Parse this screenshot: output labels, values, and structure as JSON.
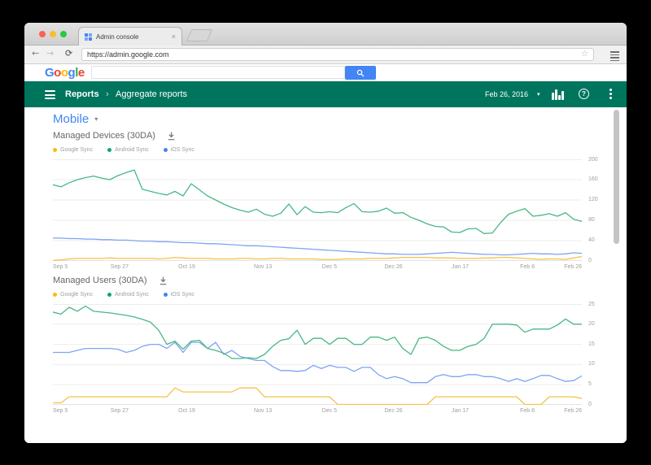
{
  "browser": {
    "tab_title": "Admin console",
    "tab_close": "×",
    "url": "https://admin.google.com",
    "back_icon": "←",
    "forward_icon": "→",
    "reload_icon": "⟳",
    "bookmark_star": "☆"
  },
  "google_bar": {
    "logo_letters": [
      {
        "ch": "G",
        "color": "#4285F4"
      },
      {
        "ch": "o",
        "color": "#EA4335"
      },
      {
        "ch": "o",
        "color": "#FBBC05"
      },
      {
        "ch": "g",
        "color": "#4285F4"
      },
      {
        "ch": "l",
        "color": "#34A853"
      },
      {
        "ch": "e",
        "color": "#EA4335"
      }
    ],
    "search_value": "",
    "search_button_icon": "magnifier"
  },
  "header": {
    "menu_icon": "hamburger",
    "breadcrumb_root": "Reports",
    "breadcrumb_separator": "›",
    "breadcrumb_current": "Aggregate reports",
    "date_label": "Feb 26, 2016",
    "date_caret": "▾",
    "right_icons": [
      "reports-bars",
      "help",
      "overflow-menu"
    ],
    "accent_green": "#00755e"
  },
  "mobile_section": {
    "title": "Mobile",
    "caret": "▾",
    "title_color": "#4285f4"
  },
  "chart_data": [
    {
      "type": "line",
      "title": "Managed Devices (30DA)",
      "actions": [
        "download"
      ],
      "grid": true,
      "legend_position": "top-left",
      "ylim": [
        0,
        200
      ],
      "y_ticks": [
        0,
        40,
        80,
        120,
        160,
        200
      ],
      "x_labels": [
        "Sep 5",
        "Sep 27",
        "Oct 19",
        "Nov 13",
        "Dec 5",
        "Dec 26",
        "Jan 17",
        "Feb 8",
        "Feb 26"
      ],
      "x_label_fractions": [
        0,
        0.126,
        0.253,
        0.397,
        0.523,
        0.644,
        0.77,
        0.897,
        1
      ],
      "series": [
        {
          "name": "Google Sync",
          "color": "#F6C14B",
          "dot_color": "#FBBC05",
          "values": [
            1,
            2,
            4,
            5,
            5,
            5,
            5,
            6,
            5,
            5,
            5,
            5,
            5,
            4,
            5,
            7,
            6,
            5,
            5,
            5,
            4,
            4,
            4,
            5,
            5,
            4,
            4,
            5,
            5,
            4,
            4,
            4,
            4,
            3,
            3,
            3,
            4,
            4,
            4,
            5,
            5,
            5,
            6,
            7,
            7,
            7,
            7,
            6,
            6,
            6,
            5,
            5,
            5,
            6,
            6,
            7,
            7,
            6,
            5,
            4,
            3,
            4,
            4,
            3,
            6,
            9
          ]
        },
        {
          "name": "Android Sync",
          "color": "#47B784",
          "dot_color": "#12A765",
          "values": [
            150,
            146,
            154,
            160,
            164,
            167,
            163,
            160,
            168,
            174,
            179,
            141,
            137,
            133,
            130,
            137,
            128,
            152,
            140,
            128,
            120,
            112,
            105,
            100,
            96,
            102,
            92,
            88,
            94,
            112,
            91,
            107,
            96,
            95,
            97,
            95,
            105,
            113,
            97,
            96,
            98,
            104,
            94,
            95,
            86,
            80,
            73,
            68,
            67,
            57,
            56,
            63,
            64,
            54,
            55,
            75,
            92,
            98,
            103,
            88,
            90,
            93,
            88,
            95,
            82,
            78
          ]
        },
        {
          "name": "iOS Sync",
          "color": "#7EA4F2",
          "dot_color": "#4285F4",
          "values": [
            45,
            45,
            44,
            44,
            43,
            43,
            42,
            42,
            41,
            41,
            40,
            39,
            39,
            38,
            38,
            37,
            36,
            36,
            35,
            34,
            34,
            33,
            32,
            31,
            30,
            30,
            29,
            28,
            27,
            26,
            25,
            24,
            23,
            22,
            21,
            20,
            19,
            18,
            17,
            16,
            15,
            14,
            14,
            13,
            13,
            13,
            14,
            15,
            16,
            17,
            16,
            15,
            14,
            13,
            13,
            12,
            12,
            13,
            14,
            15,
            14,
            14,
            13,
            14,
            16,
            15
          ]
        }
      ]
    },
    {
      "type": "line",
      "title": "Managed Users (30DA)",
      "actions": [
        "download"
      ],
      "grid": true,
      "legend_position": "top-left",
      "ylim": [
        0,
        25
      ],
      "y_ticks": [
        0,
        5,
        10,
        15,
        20,
        25
      ],
      "x_labels": [
        "Sep 5",
        "Sep 27",
        "Oct 19",
        "Nov 13",
        "Dec 5",
        "Dec 26",
        "Jan 17",
        "Feb 8",
        "Feb 26"
      ],
      "x_label_fractions": [
        0,
        0.126,
        0.253,
        0.397,
        0.523,
        0.644,
        0.77,
        0.897,
        1
      ],
      "series": [
        {
          "name": "Google Sync",
          "color": "#F6C14B",
          "dot_color": "#FBBC05",
          "values": [
            0.5,
            0.5,
            2,
            2,
            2,
            2,
            2,
            2,
            2,
            2,
            2,
            2,
            2,
            2,
            2,
            4.2,
            3.2,
            3.2,
            3.2,
            3.2,
            3.2,
            3.2,
            3.2,
            4.2,
            4.2,
            4.2,
            2,
            2,
            2,
            2,
            2,
            2,
            2,
            2,
            2,
            0,
            0,
            0,
            0,
            0,
            0,
            0,
            0,
            0,
            0,
            0,
            0,
            2,
            2,
            2,
            2,
            2,
            2,
            2,
            2,
            2,
            2,
            2,
            0,
            0,
            0,
            2,
            2,
            2,
            2,
            1.6
          ]
        },
        {
          "name": "Android Sync",
          "color": "#47B784",
          "dot_color": "#12A765",
          "values": [
            23,
            22.5,
            24.2,
            23.2,
            24.5,
            23.2,
            23,
            22.8,
            22.5,
            22.2,
            21.8,
            21.2,
            20.5,
            18.5,
            15,
            15.8,
            13.8,
            15.8,
            16,
            14,
            13.5,
            12.8,
            11.5,
            11.5,
            11.7,
            11.5,
            12.5,
            14.5,
            16,
            16.4,
            18.5,
            15,
            16.5,
            16.5,
            15,
            16.5,
            16.5,
            15,
            15,
            16.8,
            16.8,
            16,
            16.8,
            14,
            12.5,
            16.5,
            16.8,
            16,
            14.5,
            13.5,
            13.5,
            14.5,
            15,
            16.5,
            20,
            20,
            20,
            19.8,
            18,
            18.8,
            18.8,
            18.8,
            19.8,
            21.3,
            20,
            20
          ]
        },
        {
          "name": "iOS Sync",
          "color": "#7EA4F2",
          "dot_color": "#4285F4",
          "values": [
            13,
            13,
            13,
            13.5,
            14,
            14,
            14,
            14,
            13.8,
            13,
            13.5,
            14.5,
            15,
            15,
            14,
            15.5,
            13,
            15.5,
            15.5,
            14,
            15.5,
            12.5,
            13.5,
            12,
            11.5,
            11,
            11,
            9.5,
            8.5,
            8.5,
            8.3,
            8.5,
            9.8,
            9,
            9.8,
            9.3,
            9.3,
            8.3,
            9.3,
            9.3,
            7.5,
            6.5,
            7,
            6.5,
            5.5,
            5.5,
            5.5,
            7,
            7.5,
            7,
            7,
            7.5,
            7.5,
            7,
            7,
            6.5,
            5.8,
            6.5,
            5.8,
            6.5,
            7.3,
            7.3,
            6.5,
            5.8,
            6,
            7.2
          ]
        }
      ]
    }
  ]
}
